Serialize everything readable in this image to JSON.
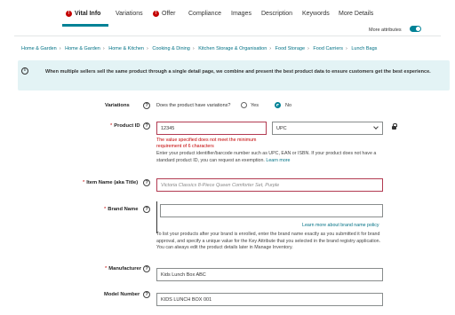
{
  "tabs": [
    {
      "label": "Vital Info",
      "error": true,
      "active": true
    },
    {
      "label": "Variations",
      "error": false,
      "active": false
    },
    {
      "label": "Offer",
      "error": true,
      "active": false
    },
    {
      "label": "Compliance",
      "error": false,
      "active": false
    },
    {
      "label": "Images",
      "error": false,
      "active": false
    },
    {
      "label": "Description",
      "error": false,
      "active": false
    },
    {
      "label": "Keywords",
      "error": false,
      "active": false
    },
    {
      "label": "More Details",
      "error": false,
      "active": false
    }
  ],
  "more_attributes": {
    "label": "More attributes",
    "enabled": true
  },
  "breadcrumb": [
    "Home & Garden",
    "Home & Garden",
    "Home & Kitchen",
    "Cooking & Dining",
    "Kitchen Storage & Organisation",
    "Food Storage",
    "Food Carriers",
    "Lunch Bags"
  ],
  "info_banner": {
    "text": "When multiple sellers sell the same product through a single detail page, we combine and present the best product data to ensure customers get the best experience."
  },
  "variations": {
    "label": "Variations",
    "question": "Does the product have variations?",
    "options": [
      "Yes",
      "No"
    ],
    "selected": "No"
  },
  "product_id": {
    "label": "Product ID",
    "value": "12345",
    "type_value": "UPC",
    "error": "The value specified does not meet the minimum requirement of 6 characters",
    "helper": "Enter your product identifier/barcode number such as UPC, EAN or ISBN. If your product does not have a standard product ID, you can request an exemption.",
    "learn_more": "Learn more"
  },
  "item_name": {
    "label": "Item Name (aka Title)",
    "placeholder": "Victoria Classics 8-Piece Queen Comforter Set, Purple"
  },
  "brand_name": {
    "label": "Brand Name",
    "value": "",
    "policy_link": "Learn more about brand name policy",
    "helper": "To list your products after your brand is enrolled, enter the brand name exactly as you submitted it for brand approval, and specify a unique value for the Key Attribute that you selected in the brand registry application. You can always edit the product details later in Manage Inventory."
  },
  "manufacturer": {
    "label": "Manufacturer",
    "value": "Kids Lunch Box ABC"
  },
  "model_number": {
    "label": "Model Number",
    "value": "KIDS LUNCH BOX 001"
  },
  "colors": {
    "accent": "#008296",
    "error": "#c40000",
    "link": "#007185",
    "banner": "#e3f3f5"
  }
}
